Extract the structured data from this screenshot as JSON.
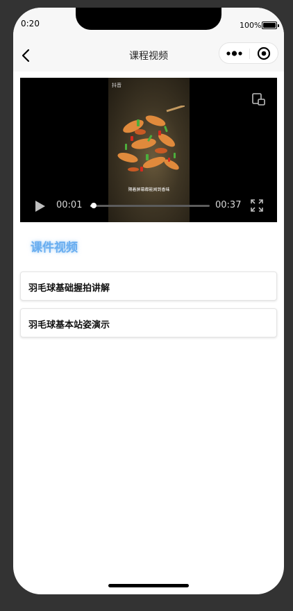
{
  "status_bar": {
    "time": "0:20",
    "battery": "100%"
  },
  "nav": {
    "title": "课程视频"
  },
  "video": {
    "current_time": "00:01",
    "total_time": "00:37",
    "progress_fraction": 0.027,
    "caption": "隔着屏幕都能闻到香味",
    "watermark": "抖音"
  },
  "section": {
    "title": "课件视频"
  },
  "lessons": [
    {
      "label": "羽毛球基础握拍讲解"
    },
    {
      "label": "羽毛球基本站姿演示"
    }
  ],
  "colors": {
    "accent": "#6aaef0",
    "background": "#333333",
    "nav_background": "#f7f7f7"
  }
}
